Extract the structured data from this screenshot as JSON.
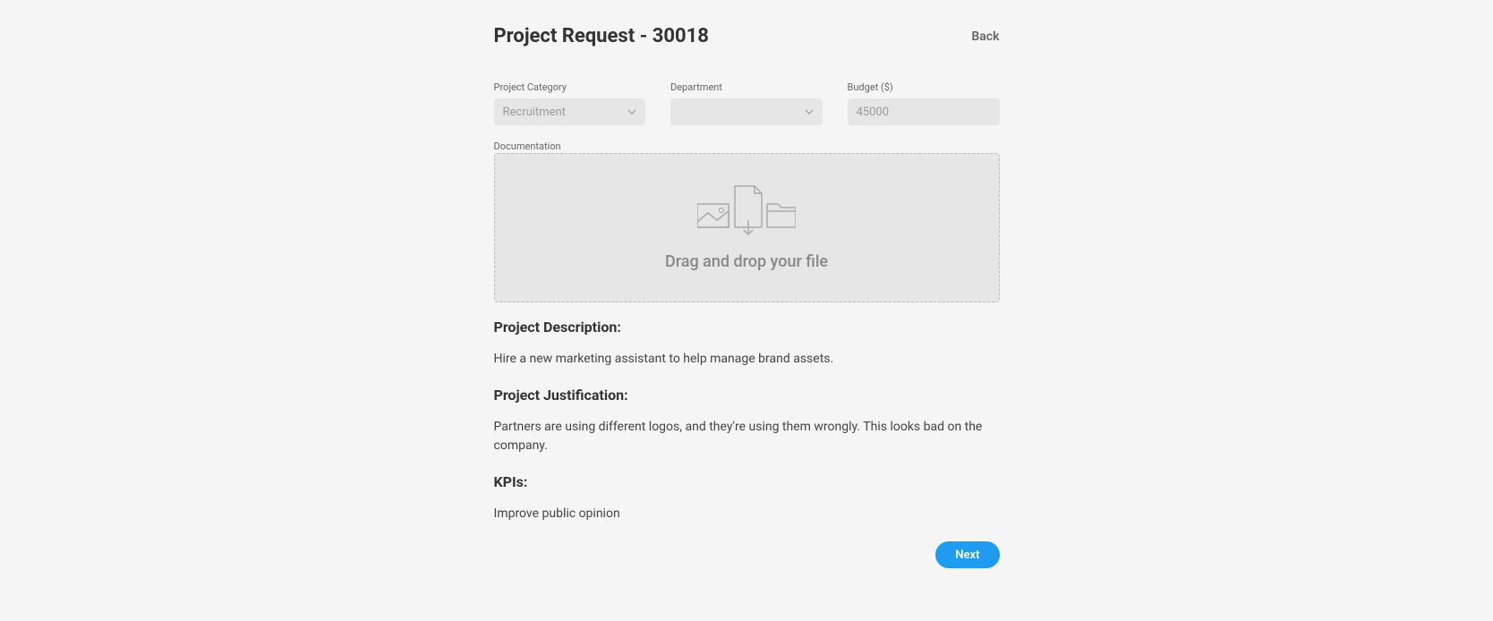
{
  "header": {
    "title": "Project Request - 30018",
    "back_label": "Back"
  },
  "form": {
    "project_category": {
      "label": "Project Category",
      "value": "Recruitment"
    },
    "department": {
      "label": "Department",
      "value": ""
    },
    "budget": {
      "label": "Budget ($)",
      "placeholder": "45000"
    },
    "documentation": {
      "label": "Documentation",
      "dropzone_text": "Drag and drop your file"
    }
  },
  "sections": {
    "description": {
      "heading": "Project Description:",
      "text": "Hire a new marketing assistant to help manage brand assets."
    },
    "justification": {
      "heading": "Project Justification:",
      "text": "Partners are using different logos, and they're using them wrongly. This looks bad on the company."
    },
    "kpis": {
      "heading": "KPIs:",
      "text": "Improve public opinion"
    }
  },
  "actions": {
    "next_label": "Next"
  }
}
